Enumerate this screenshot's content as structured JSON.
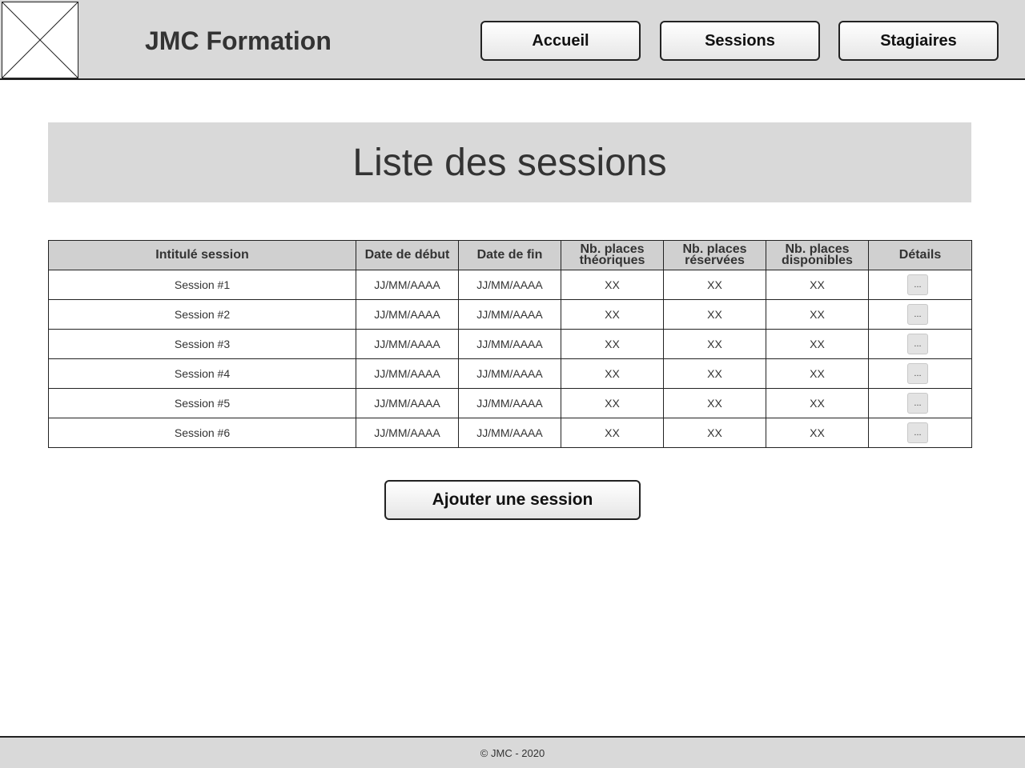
{
  "header": {
    "brand": "JMC Formation",
    "logo_icon": "image-placeholder-icon",
    "nav": [
      {
        "label": "Accueil"
      },
      {
        "label": "Sessions"
      },
      {
        "label": "Stagiaires"
      }
    ]
  },
  "main": {
    "title": "Liste des sessions",
    "table": {
      "columns": [
        "Intitulé session",
        "Date de début",
        "Date de fin",
        "Nb. places théoriques",
        "Nb. places réservées",
        "Nb. places disponibles",
        "Détails"
      ],
      "column_lines": {
        "col4": [
          "Nb. places",
          "théoriques"
        ],
        "col5": [
          "Nb. places",
          "réservées"
        ],
        "col6": [
          "Nb. places",
          "disponibles"
        ]
      },
      "rows": [
        {
          "name": "Session #1",
          "start": "JJ/MM/AAAA",
          "end": "JJ/MM/AAAA",
          "theoretical": "XX",
          "reserved": "XX",
          "available": "XX",
          "details": "..."
        },
        {
          "name": "Session #2",
          "start": "JJ/MM/AAAA",
          "end": "JJ/MM/AAAA",
          "theoretical": "XX",
          "reserved": "XX",
          "available": "XX",
          "details": "..."
        },
        {
          "name": "Session #3",
          "start": "JJ/MM/AAAA",
          "end": "JJ/MM/AAAA",
          "theoretical": "XX",
          "reserved": "XX",
          "available": "XX",
          "details": "..."
        },
        {
          "name": "Session #4",
          "start": "JJ/MM/AAAA",
          "end": "JJ/MM/AAAA",
          "theoretical": "XX",
          "reserved": "XX",
          "available": "XX",
          "details": "..."
        },
        {
          "name": "Session #5",
          "start": "JJ/MM/AAAA",
          "end": "JJ/MM/AAAA",
          "theoretical": "XX",
          "reserved": "XX",
          "available": "XX",
          "details": "..."
        },
        {
          "name": "Session #6",
          "start": "JJ/MM/AAAA",
          "end": "JJ/MM/AAAA",
          "theoretical": "XX",
          "reserved": "XX",
          "available": "XX",
          "details": "..."
        }
      ]
    },
    "add_button": "Ajouter une session"
  },
  "footer": {
    "text": "© JMC - 2020"
  },
  "colors": {
    "header_bg": "#d9d9d9",
    "table_header_bg": "#d0d0d0",
    "border": "#222222"
  }
}
